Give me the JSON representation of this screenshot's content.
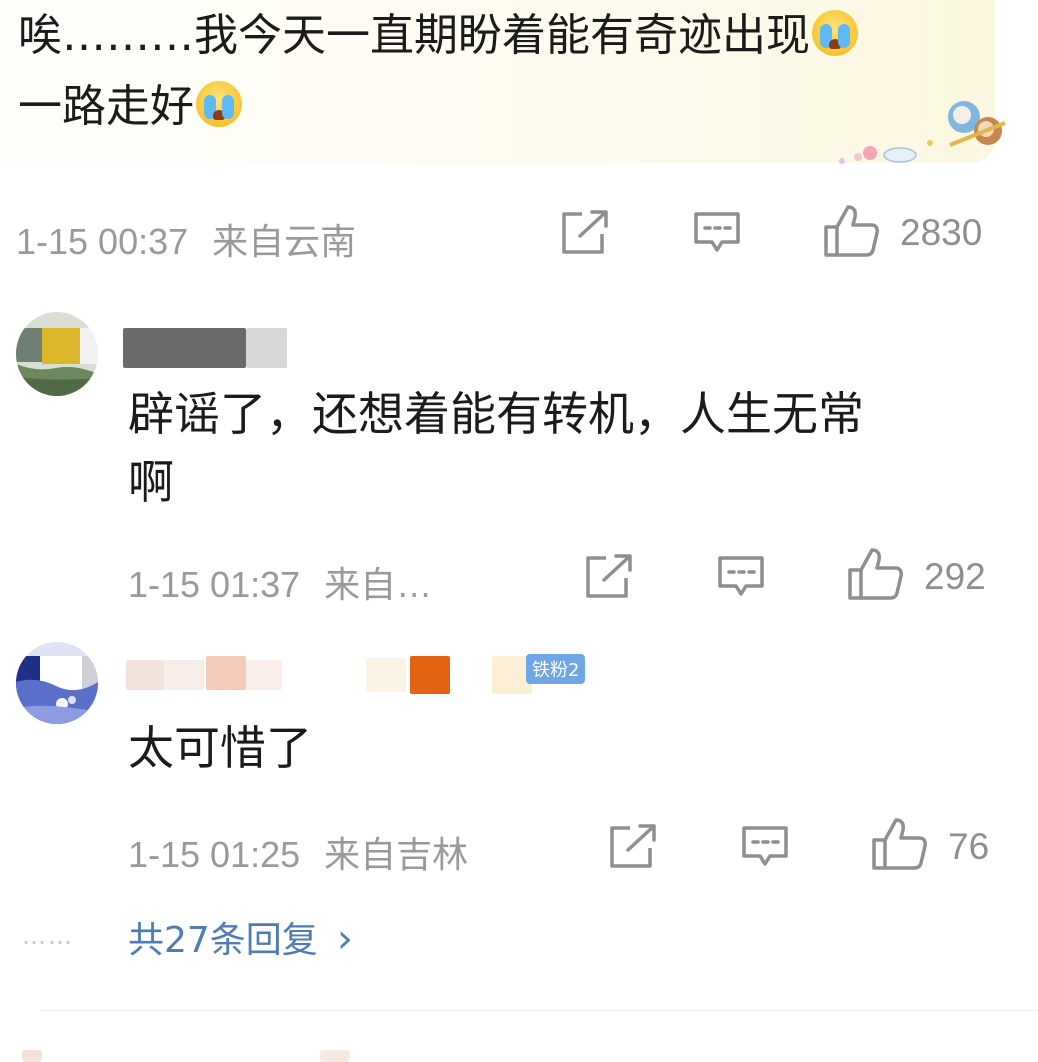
{
  "main_comment": {
    "line1": "唉………我今天一直期盼着能有奇迹出现",
    "line2": "一路走好",
    "emoji_icon": "crying-face-icon",
    "timestamp": "1-15 00:37",
    "location": "来自云南",
    "like_count": "2830"
  },
  "replies": [
    {
      "text_line1": "辟谣了，还想着能有转机，人生无常",
      "text_line2": "啊",
      "timestamp": "1-15 01:37",
      "location": "来自…",
      "like_count": "292"
    },
    {
      "badge": "铁粉2",
      "text_line1": "太可惜了",
      "timestamp": "1-15 01:25",
      "location": "来自吉林",
      "like_count": "76"
    }
  ],
  "more_replies": {
    "dots": "……",
    "label": "共27条回复",
    "chevron": "›"
  },
  "colors": {
    "link_blue": "#4f7db3",
    "meta_gray": "#9a9a9a",
    "badge_blue": "#6ea6e6"
  }
}
